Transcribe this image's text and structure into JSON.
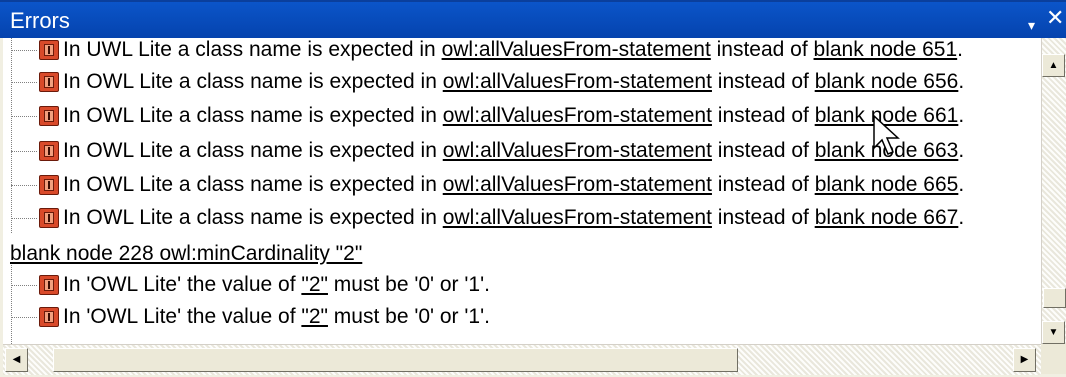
{
  "panel": {
    "title": "Errors",
    "menu_glyph": "▾",
    "close_glyph": "✕"
  },
  "rows": [
    {
      "kind": "error",
      "pre": "In UWL Lite a class name is expected in ",
      "link1": "owl:allValuesFrom-statement",
      "mid": " instead of ",
      "link2": "blank node 651",
      "post": "."
    },
    {
      "kind": "error",
      "pre": "In OWL Lite a class name is expected in ",
      "link1": "owl:allValuesFrom-statement",
      "mid": " instead of ",
      "link2": "blank node 656",
      "post": "."
    },
    {
      "kind": "error",
      "pre": "In OWL Lite a class name is expected in ",
      "link1": "owl:allValuesFrom-statement",
      "mid": " instead of ",
      "link2": "blank node 661",
      "post": "."
    },
    {
      "kind": "error",
      "pre": "In OWL Lite a class name is expected in ",
      "link1": "owl:allValuesFrom-statement",
      "mid": " instead of ",
      "link2": "blank node 663",
      "post": "."
    },
    {
      "kind": "error",
      "pre": "In OWL Lite a class name is expected in ",
      "link1": "owl:allValuesFrom-statement",
      "mid": " instead of ",
      "link2": "blank node 665",
      "post": "."
    },
    {
      "kind": "error",
      "pre": "In OWL Lite a class name is expected in ",
      "link1": "owl:allValuesFrom-statement",
      "mid": " instead of ",
      "link2": "blank node 667",
      "post": "."
    },
    {
      "kind": "node",
      "link1": "blank node 228 owl:minCardinality \"2\""
    },
    {
      "kind": "error",
      "pre": "In 'OWL Lite' the value of ",
      "link1": "\"2\"",
      "mid": " must be '0' or '1'.",
      "link2": "",
      "post": ""
    },
    {
      "kind": "error",
      "pre": "In 'OWL Lite' the value of ",
      "link1": "\"2\"",
      "mid": " must be '0' or '1'.",
      "link2": "",
      "post": ""
    }
  ],
  "scroll": {
    "up": "▲",
    "down": "▼",
    "left": "◀",
    "right": "▶"
  }
}
